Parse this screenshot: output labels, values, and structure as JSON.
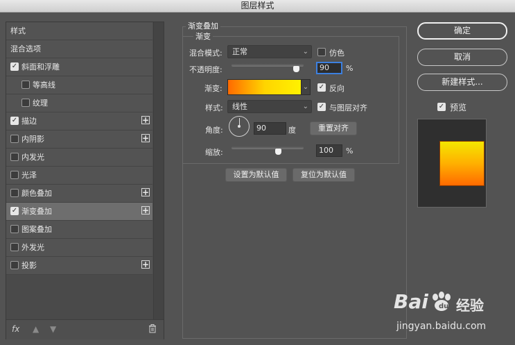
{
  "window": {
    "title": "图层样式"
  },
  "left_panel": {
    "items": [
      {
        "label": "样式",
        "kind": "header"
      },
      {
        "label": "混合选项",
        "kind": "header"
      },
      {
        "label": "斜面和浮雕",
        "checked": true,
        "indent": 0,
        "plus": false
      },
      {
        "label": "等高线",
        "checked": false,
        "indent": 1,
        "plus": false
      },
      {
        "label": "纹理",
        "checked": false,
        "indent": 1,
        "plus": false
      },
      {
        "label": "描边",
        "checked": true,
        "indent": 0,
        "plus": true
      },
      {
        "label": "内阴影",
        "checked": false,
        "indent": 0,
        "plus": true
      },
      {
        "label": "内发光",
        "checked": false,
        "indent": 0,
        "plus": false
      },
      {
        "label": "光泽",
        "checked": false,
        "indent": 0,
        "plus": false
      },
      {
        "label": "颜色叠加",
        "checked": false,
        "indent": 0,
        "plus": true
      },
      {
        "label": "渐变叠加",
        "checked": true,
        "indent": 0,
        "plus": true,
        "selected": true
      },
      {
        "label": "图案叠加",
        "checked": false,
        "indent": 0,
        "plus": false
      },
      {
        "label": "外发光",
        "checked": false,
        "indent": 0,
        "plus": false
      },
      {
        "label": "投影",
        "checked": false,
        "indent": 0,
        "plus": true
      }
    ],
    "bottom": {
      "fx": "fx",
      "up_icon": "arrow-up-icon",
      "down_icon": "arrow-down-icon",
      "trash_icon": "trash-icon"
    }
  },
  "gradient_overlay": {
    "section_title": "渐变叠加",
    "group_title": "渐变",
    "blend_mode_label": "混合模式:",
    "blend_mode_value": "正常",
    "dither_label": "仿色",
    "dither_checked": false,
    "opacity_label": "不透明度:",
    "opacity_value": "90",
    "opacity_unit": "%",
    "opacity_percent": 90,
    "gradient_label": "渐变:",
    "gradient_colors": [
      "#ff6a00",
      "#ffd400",
      "#fff200"
    ],
    "reverse_label": "反向",
    "reverse_checked": true,
    "style_label": "样式:",
    "style_value": "线性",
    "align_label": "与图层对齐",
    "align_checked": true,
    "angle_label": "角度:",
    "angle_value": "90",
    "angle_unit": "度",
    "reset_align_label": "重置对齐",
    "scale_label": "缩放:",
    "scale_value": "100",
    "scale_unit": "%",
    "scale_percent": 100,
    "make_default_label": "设置为默认值",
    "reset_default_label": "复位为默认值"
  },
  "actions": {
    "ok_label": "确定",
    "cancel_label": "取消",
    "new_style_label": "新建样式...",
    "preview_label": "预览",
    "preview_checked": true
  },
  "watermark": {
    "brand": "Bai",
    "brand2": "经验",
    "url": "jingyan.baidu.com"
  }
}
